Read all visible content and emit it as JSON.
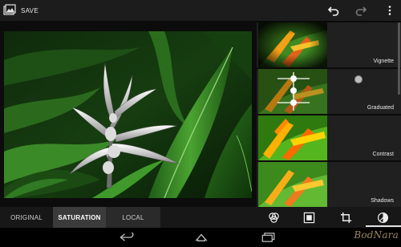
{
  "actionbar": {
    "save_label": "SAVE",
    "icons": [
      "gallery-icon",
      "undo-icon",
      "redo-icon",
      "overflow-menu-icon"
    ]
  },
  "filters": [
    {
      "label": "Vignette"
    },
    {
      "label": "Graduated"
    },
    {
      "label": "Contrast"
    },
    {
      "label": "Shadows"
    }
  ],
  "toolbar": {
    "tabs": [
      {
        "label": "ORIGINAL"
      },
      {
        "label": "SATURATION"
      },
      {
        "label": "LOCAL"
      }
    ],
    "active_tab": "SATURATION",
    "tools": [
      "effects-icon",
      "frame-icon",
      "crop-icon",
      "tune-icon"
    ],
    "active_tool": "tune-icon"
  },
  "navbar": {
    "buttons": [
      "back-icon",
      "home-icon",
      "recent-apps-icon"
    ],
    "watermark": "BodNara"
  },
  "colors": {
    "actionbar": "#1c1c1c",
    "toolbar": "#171717",
    "active_tab": "#3b3b3b",
    "panel": "#202020",
    "leaf_green": "#2e7d22",
    "flower_orange": "#f08a10"
  }
}
